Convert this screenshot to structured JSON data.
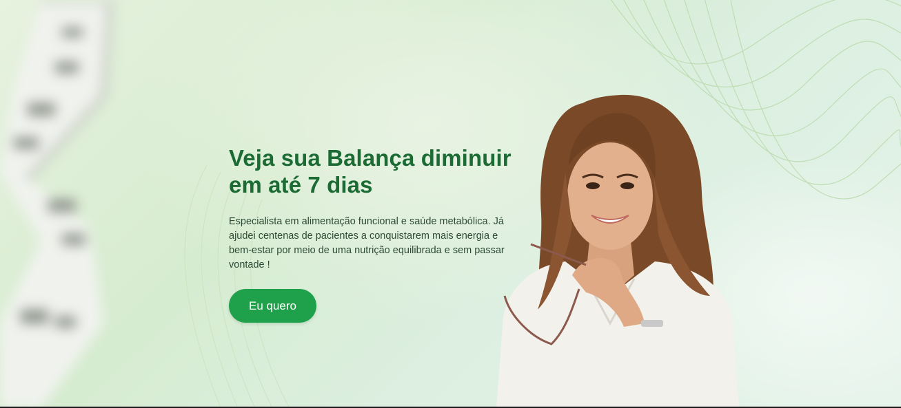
{
  "hero": {
    "headline_line1": "Veja sua Balança diminuir",
    "headline_line2": "em até 7 dias",
    "description": "Especialista em alimentação funcional e saúde metabólica. Já ajudei centenas de pacientes a conquistarem mais energia e bem-estar por meio de uma nutrição equilibrada e sem passar vontade !",
    "cta_label": "Eu quero"
  },
  "colors": {
    "headline": "#1c6b34",
    "cta_background": "#1fa04a",
    "background": "#dfeedc"
  },
  "icons": {
    "decor_left": "measuring-tape-image",
    "decor_right": "woman-with-glasses-photo"
  }
}
